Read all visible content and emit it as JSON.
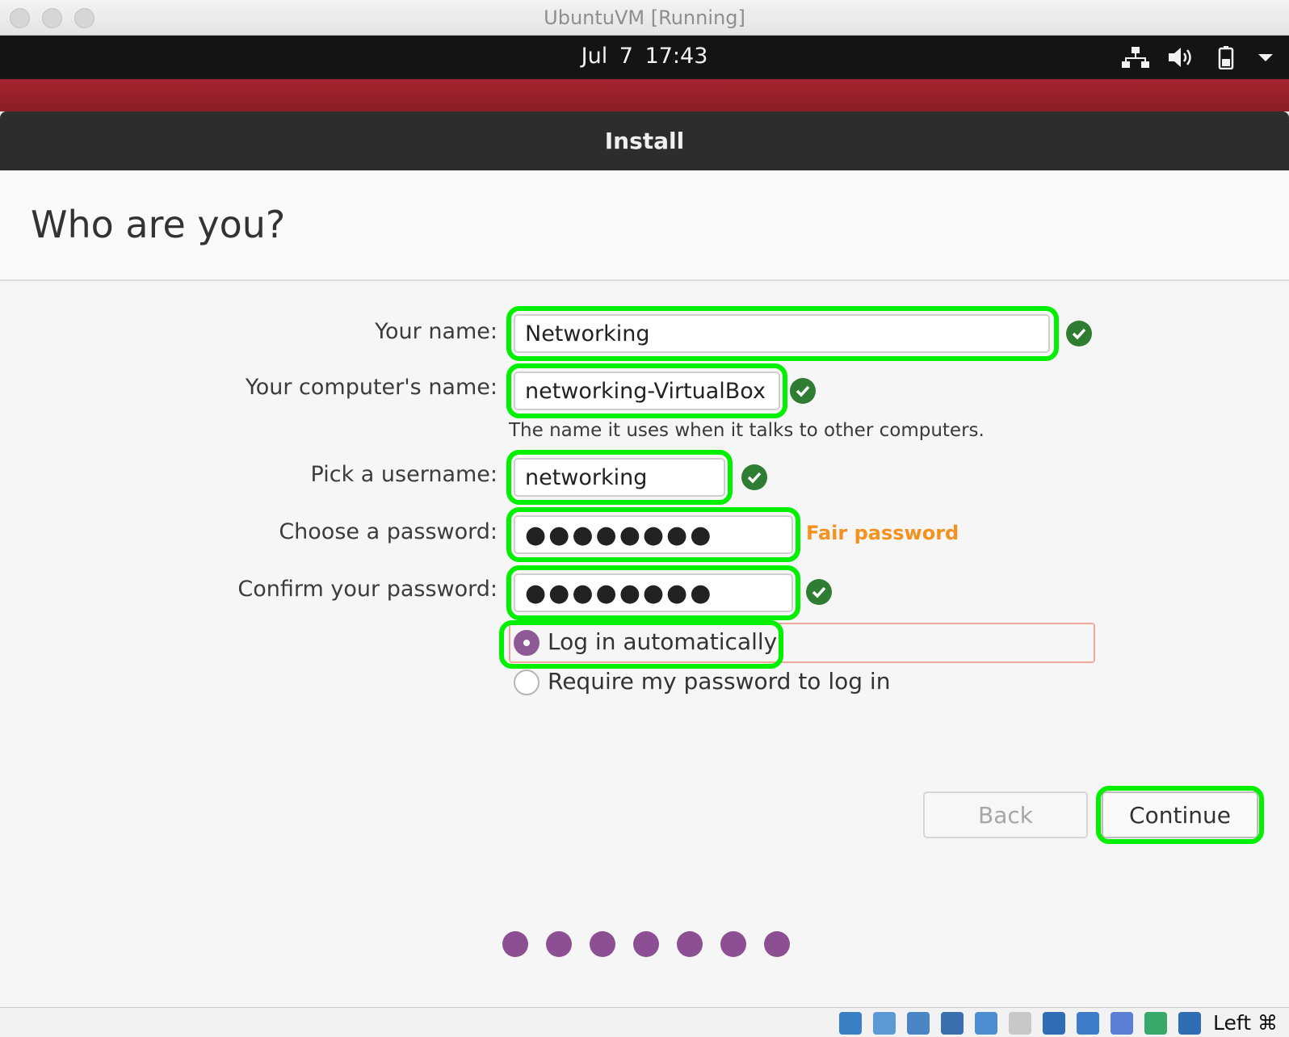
{
  "window": {
    "title": "UbuntuVM [Running]"
  },
  "topbar": {
    "date": "Jul 7",
    "time": "17:43",
    "tray_icons": [
      "network-icon",
      "volume-icon",
      "battery-icon",
      "system-menu-arrow-icon"
    ]
  },
  "installer": {
    "title": "Install",
    "heading": "Who are you?",
    "fields": {
      "name": {
        "label": "Your name:",
        "value": "Networking"
      },
      "computer": {
        "label": "Your computer's name:",
        "value": "networking-VirtualBox",
        "hint": "The name it uses when it talks to other computers."
      },
      "username": {
        "label": "Pick a username:",
        "value": "networking"
      },
      "password": {
        "label": "Choose a password:",
        "value": "●●●●●●●●",
        "strength": "Fair password"
      },
      "confirm": {
        "label": "Confirm your password:",
        "value": "●●●●●●●●"
      }
    },
    "login_options": {
      "selected": "auto",
      "auto_label": "Log in automatically",
      "require_label": "Require my password to log in"
    },
    "buttons": {
      "back": "Back",
      "continue": "Continue"
    },
    "progress": {
      "steps": 7
    }
  },
  "statusbar": {
    "icons": [
      "hard-disk-icon",
      "optical-drive-icon",
      "audio-icon",
      "network-adapter-icon",
      "usb-icon",
      "shared-folder-icon",
      "display-icon",
      "recording-icon",
      "cpu-icon",
      "mouse-integration-icon",
      "download-icon"
    ],
    "host_key": "Left ⌘"
  },
  "colors": {
    "accent_purple": "#8c4f93",
    "highlight_green": "#00f000",
    "check_green": "#2e7d32",
    "password_fair": "#f5911e",
    "desktop_red": "#a3242f"
  }
}
